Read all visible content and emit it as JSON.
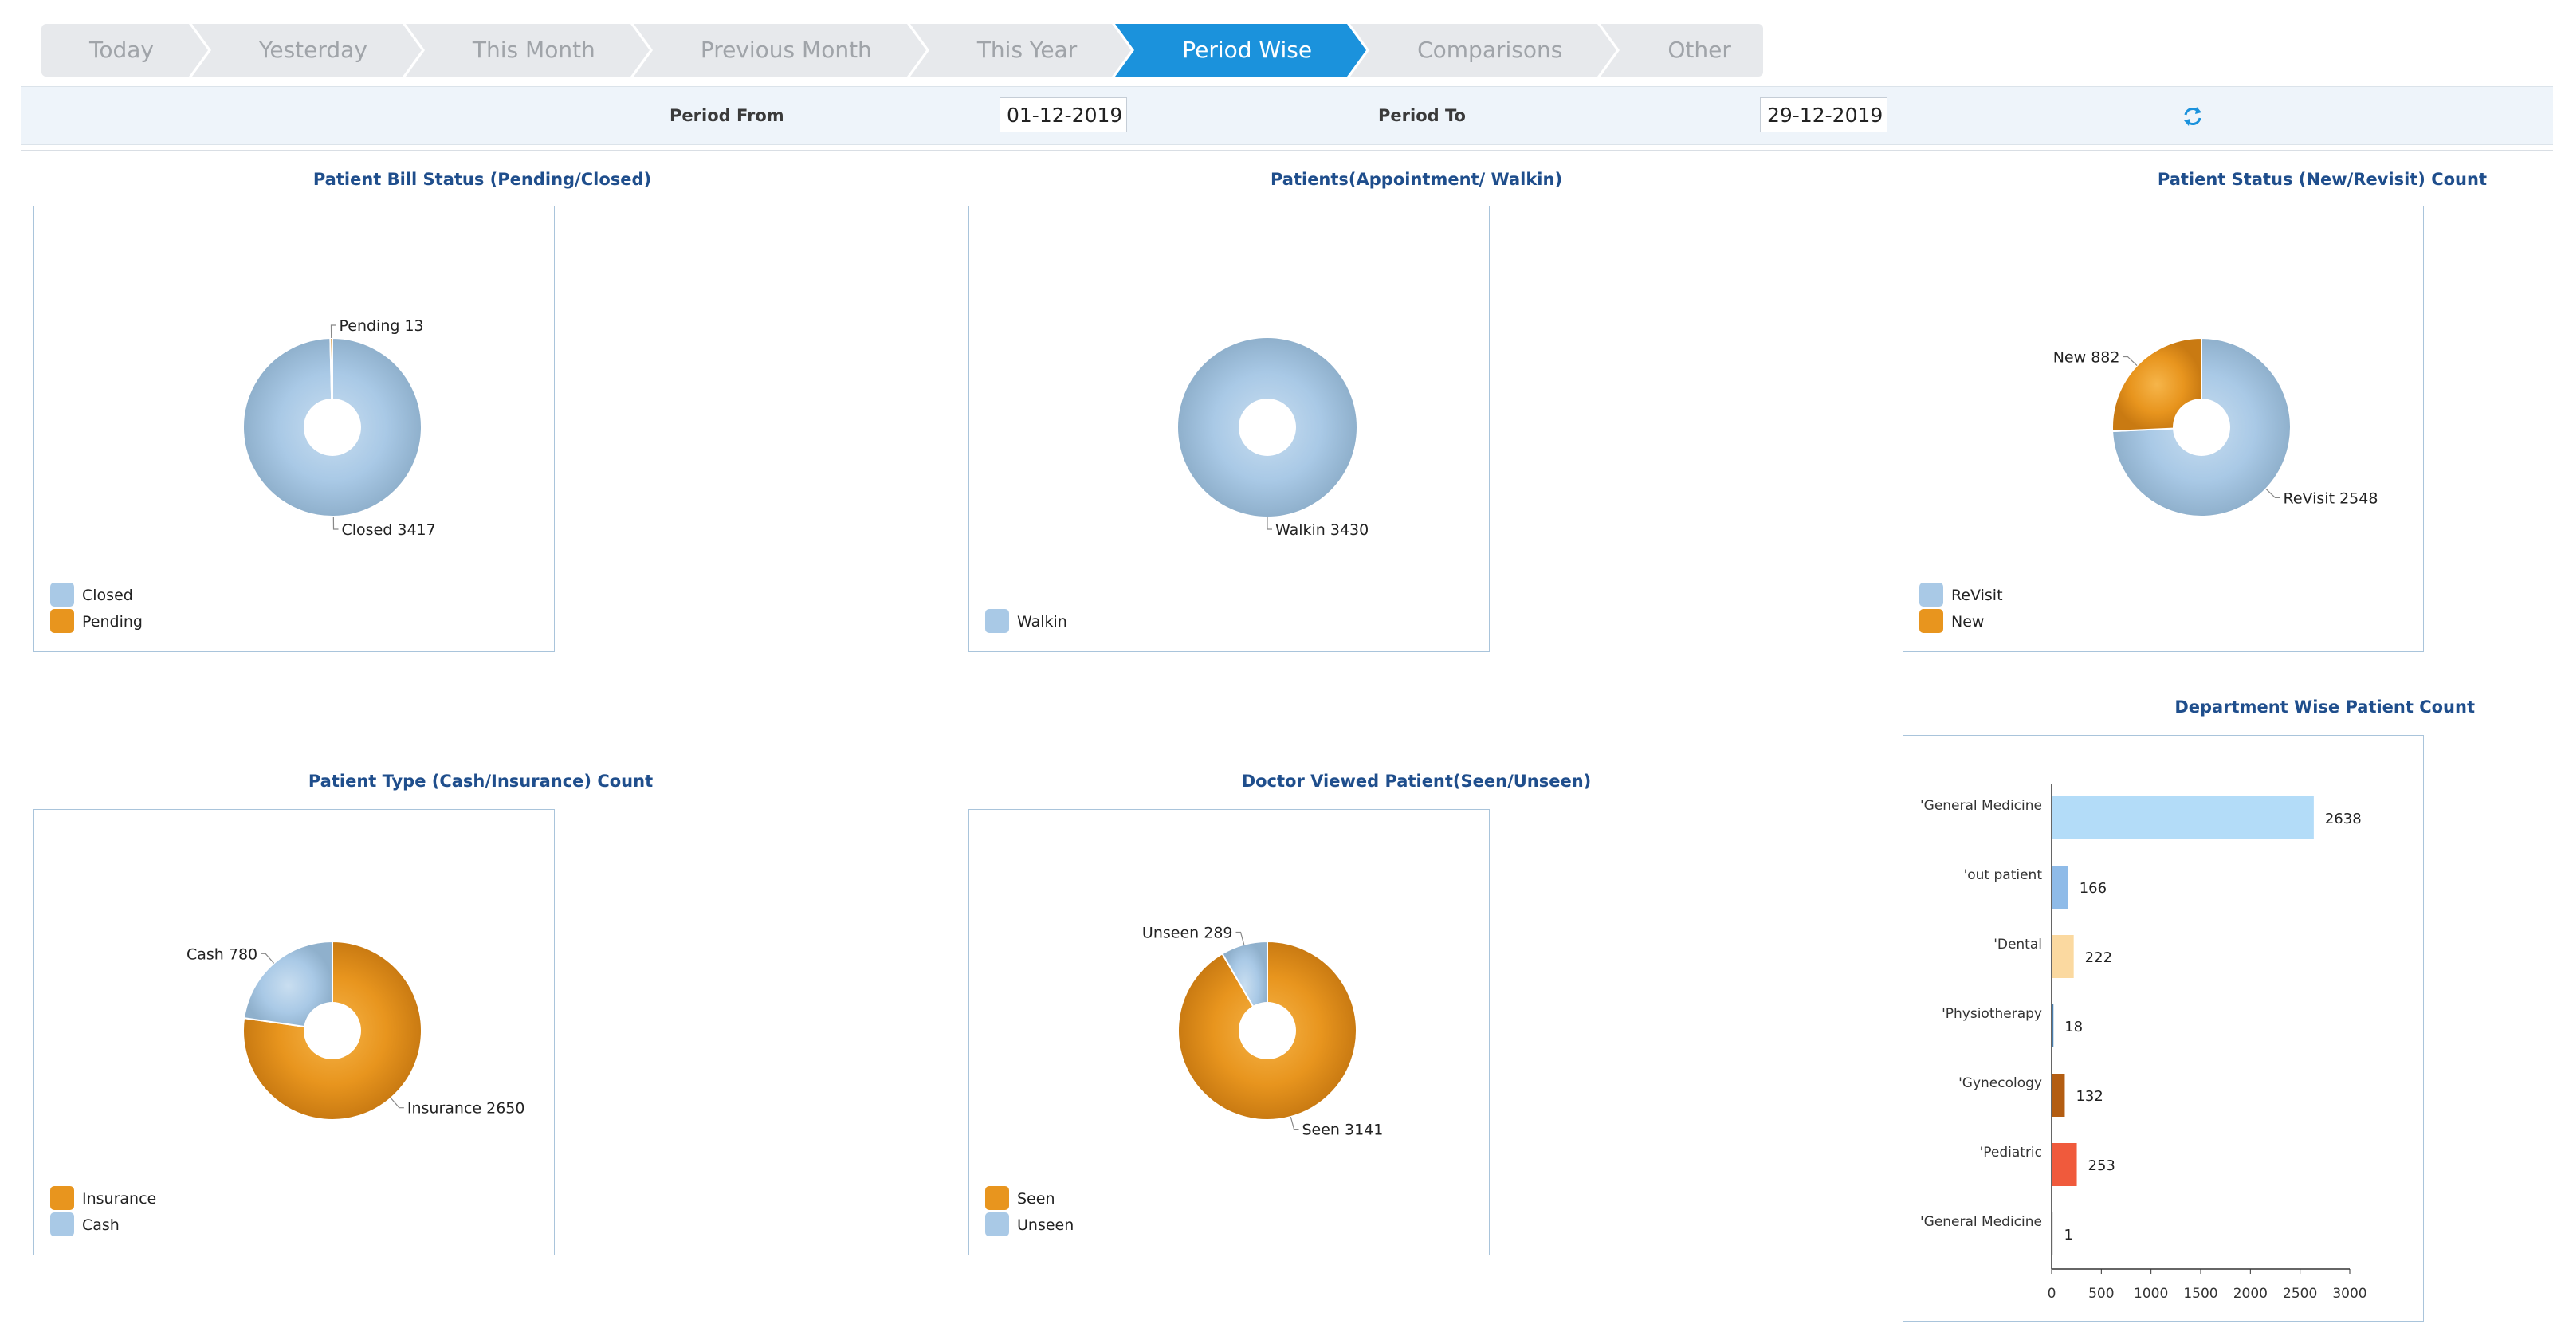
{
  "tabs": [
    {
      "label": "Today",
      "active": false
    },
    {
      "label": "Yesterday",
      "active": false
    },
    {
      "label": "This Month",
      "active": false
    },
    {
      "label": "Previous Month",
      "active": false
    },
    {
      "label": "This Year",
      "active": false
    },
    {
      "label": "Period Wise",
      "active": true
    },
    {
      "label": "Comparisons",
      "active": false
    },
    {
      "label": "Other",
      "active": false
    }
  ],
  "period": {
    "from_label": "Period From",
    "from_value": "01-12-2019",
    "to_label": "Period To",
    "to_value": "29-12-2019",
    "refresh_icon": "refresh-icon"
  },
  "colors": {
    "blue": "#a9c9e6",
    "orange": "#e8951e",
    "accent": "#1b92dc",
    "title": "#1f4e8c"
  },
  "chart_data": [
    {
      "type": "pie",
      "title": "Patient Bill Status (Pending/Closed)",
      "slices": [
        {
          "name": "Closed",
          "value": 3417,
          "label": "Closed 3417",
          "color": "#a9c9e6"
        },
        {
          "name": "Pending",
          "value": 13,
          "label": "Pending 13",
          "color": "#e8951e"
        }
      ],
      "legend": [
        "Closed",
        "Pending"
      ]
    },
    {
      "type": "pie",
      "title": "Patients(Appointment/ Walkin)",
      "slices": [
        {
          "name": "Walkin",
          "value": 3430,
          "label": "Walkin 3430",
          "color": "#a9c9e6"
        }
      ],
      "legend": [
        "Walkin"
      ]
    },
    {
      "type": "pie",
      "title": "Patient Status (New/Revisit) Count",
      "slices": [
        {
          "name": "ReVisit",
          "value": 2548,
          "label": "ReVisit 2548",
          "color": "#a9c9e6"
        },
        {
          "name": "New",
          "value": 882,
          "label": "New 882",
          "color": "#e8951e"
        }
      ],
      "legend": [
        "ReVisit",
        "New"
      ]
    },
    {
      "type": "pie",
      "title": "Patient Type (Cash/Insurance) Count",
      "slices": [
        {
          "name": "Insurance",
          "value": 2650,
          "label": "Insurance 2650",
          "color": "#e8951e"
        },
        {
          "name": "Cash",
          "value": 780,
          "label": "Cash 780",
          "color": "#a9c9e6"
        }
      ],
      "legend": [
        "Insurance",
        "Cash"
      ]
    },
    {
      "type": "pie",
      "title": "Doctor Viewed Patient(Seen/Unseen)",
      "slices": [
        {
          "name": "Seen",
          "value": 3141,
          "label": "Seen 3141",
          "color": "#e8951e"
        },
        {
          "name": "Unseen",
          "value": 289,
          "label": "Unseen 289",
          "color": "#a9c9e6"
        }
      ],
      "legend": [
        "Seen",
        "Unseen"
      ]
    },
    {
      "type": "bar",
      "orientation": "horizontal",
      "title": "Department Wise Patient Count",
      "categories": [
        "'General Medicine",
        "'out patient",
        "'Dental",
        "'Physiotherapy",
        "'Gynecology",
        "'Pediatric",
        "'General Medicine"
      ],
      "values": [
        2638,
        166,
        222,
        18,
        132,
        253,
        1
      ],
      "colors": [
        "#b3dcf8",
        "#8fbbe8",
        "#fbd9a0",
        "#4a7fae",
        "#b35d12",
        "#f05a3c",
        "#cccccc"
      ],
      "xlim": [
        0,
        3000
      ],
      "xticks": [
        0,
        500,
        1000,
        1500,
        2000,
        2500,
        3000
      ]
    }
  ]
}
